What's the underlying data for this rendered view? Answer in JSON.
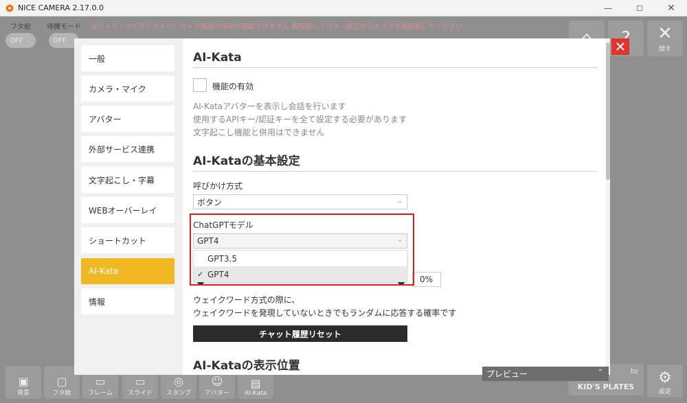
{
  "window": {
    "title": "NICE CAMERA 2.17.0.0"
  },
  "app": {
    "toggles": [
      {
        "label": "フタ絵",
        "state": "OFF"
      },
      {
        "label": "待機モード",
        "state": "OFF"
      }
    ],
    "warning": "カメラ・マイク＞カメラ：カメラ機器の接続が確認できません 再接続しアバター設定からカメラを再起動してください",
    "top_icons": [
      {
        "icon": "home-icon",
        "caption": ""
      },
      {
        "icon": "help-icon",
        "caption": "プ"
      },
      {
        "icon": "close-icon",
        "caption": "閉す"
      }
    ],
    "bottom_icons": [
      {
        "icon": "image-icon",
        "caption": "背景"
      },
      {
        "icon": "frame-icon",
        "caption": "フタ絵"
      },
      {
        "icon": "frame2-icon",
        "caption": "フレーム"
      },
      {
        "icon": "slide-icon",
        "caption": "スライド"
      },
      {
        "icon": "stamp-icon",
        "caption": "スタンプ"
      },
      {
        "icon": "avatar-icon",
        "caption": "アバター"
      },
      {
        "icon": "ai-icon",
        "caption": "AI-Kata"
      }
    ],
    "brand": "KID'S PLATES",
    "brand_prefix": "by",
    "settings_caption": "設定"
  },
  "sidebar": {
    "items": [
      {
        "label": "一般"
      },
      {
        "label": "カメラ・マイク"
      },
      {
        "label": "アバター"
      },
      {
        "label": "外部サービス連携"
      },
      {
        "label": "文字起こし・字幕"
      },
      {
        "label": "WEBオーバーレイ"
      },
      {
        "label": "ショートカット"
      },
      {
        "label": "AI-Kata",
        "active": true
      },
      {
        "label": "情報"
      }
    ]
  },
  "content": {
    "section1_title": "AI-Kata",
    "enable_label": "機能の有効",
    "desc": [
      "AI-Kataアバターを表示し会話を行います",
      "使用するAPIキー/認証キーを全て設定する必要があります",
      "文字起こし機能と併用はできません"
    ],
    "section2_title": "AI-Kataの基本設定",
    "call_method_label": "呼びかけ方式",
    "call_method_value": "ボタン",
    "gpt_model_label": "ChatGPTモデル",
    "gpt_model_value": "GPT4",
    "gpt_model_options": [
      "GPT3.5",
      "GPT4"
    ],
    "random_prob_value": "0%",
    "random_desc": [
      "ウェイクワード方式の際に、",
      "ウェイクワードを発現していないときでもランダムに応答する確率です"
    ],
    "reset_button": "チャット履歴リセット",
    "section3_title": "AI-Kataの表示位置"
  },
  "preview": {
    "label": "プレビュー"
  },
  "colors": {
    "accent": "#f0b922",
    "highlight": "#e21b1b",
    "close": "#e0352d"
  }
}
